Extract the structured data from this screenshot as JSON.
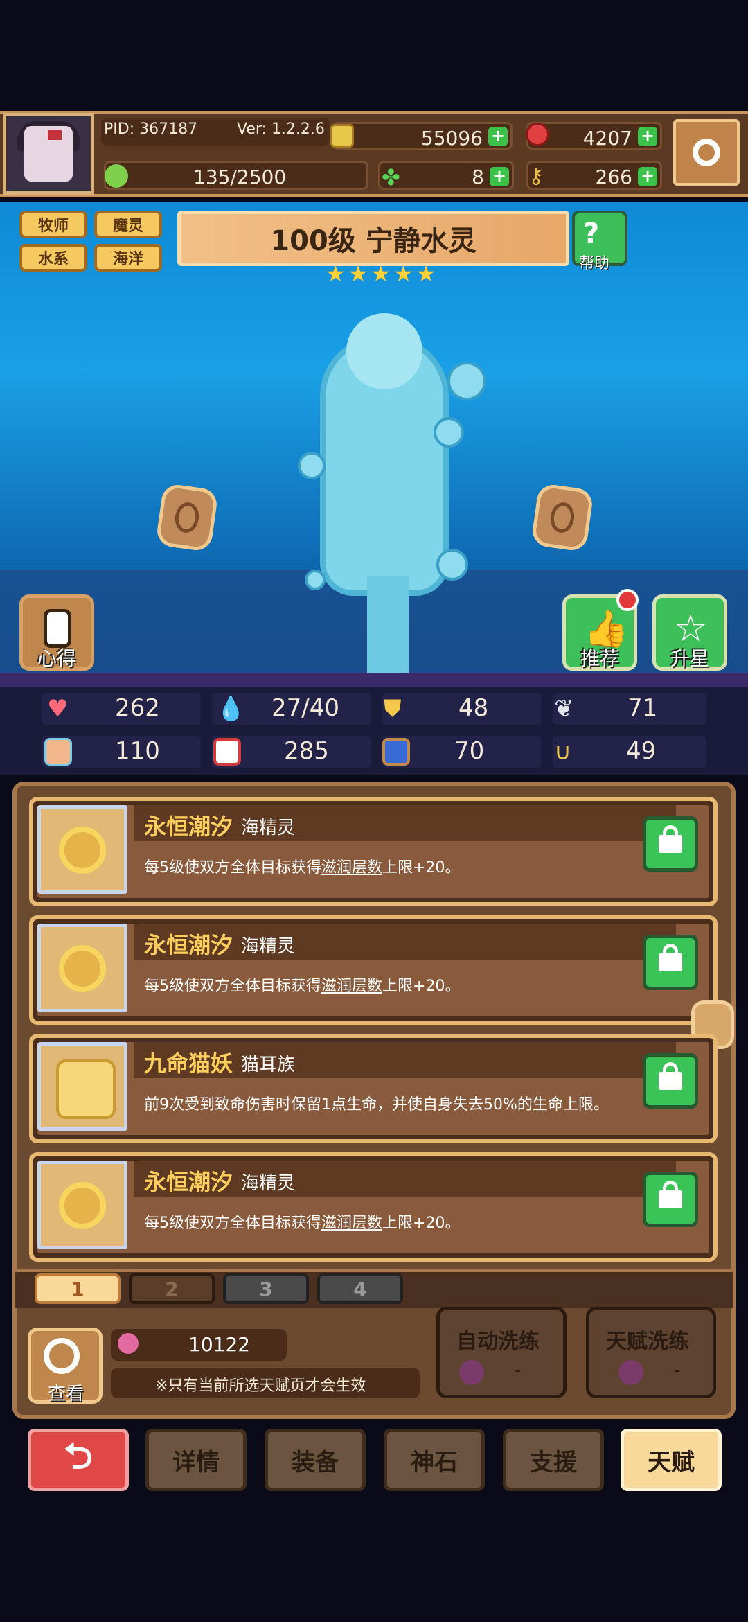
{
  "header": {
    "pid": "PID: 367187",
    "version": "Ver: 1.2.2.6",
    "gold": "55096",
    "gems": "4207",
    "energy": "135/2500",
    "clover": "8",
    "key": "266"
  },
  "hero": {
    "tags": [
      "牧师",
      "魔灵",
      "水系",
      "海洋"
    ],
    "title": "100级 宁静水灵",
    "stars": 5,
    "help_label": "帮助",
    "left_button": "心得",
    "recommend_button": "推荐",
    "upstar_button": "升星"
  },
  "stats": {
    "hp": "262",
    "water": "27/40",
    "def": "48",
    "speed": "71",
    "atk": "110",
    "book": "285",
    "ladder": "70",
    "magnet": "49"
  },
  "talents": [
    {
      "name": "永恒潮汐",
      "race": "海精灵",
      "desc_pre": "每5级使双方全体目标获得",
      "desc_link": "滋润层数",
      "desc_post": "上限+20。"
    },
    {
      "name": "永恒潮汐",
      "race": "海精灵",
      "desc_pre": "每5级使双方全体目标获得",
      "desc_link": "滋润层数",
      "desc_post": "上限+20。"
    },
    {
      "name": "九命猫妖",
      "race": "猫耳族",
      "desc_pre": "前9次受到致命伤害时保留1点生命，并使自身失去50%的生命上限。",
      "desc_link": "",
      "desc_post": ""
    },
    {
      "name": "永恒潮汐",
      "race": "海精灵",
      "desc_pre": "每5级使双方全体目标获得",
      "desc_link": "滋润层数",
      "desc_post": "上限+20。"
    }
  ],
  "pages": [
    "1",
    "2",
    "3",
    "4"
  ],
  "bottom": {
    "view_label": "查看",
    "currency": "10122",
    "note": "※只有当前所选天赋页才会生效",
    "auto_refine": "自动洗练",
    "auto_refine_cost": "-",
    "talent_refine": "天赋洗练",
    "talent_refine_cost": "-"
  },
  "nav": [
    "详情",
    "装备",
    "神石",
    "支援",
    "天赋"
  ],
  "colors": {
    "accent": "#f5c860",
    "lock_green": "#3ac458",
    "back_red": "#e04848",
    "active_tab": "#f8d99a"
  }
}
